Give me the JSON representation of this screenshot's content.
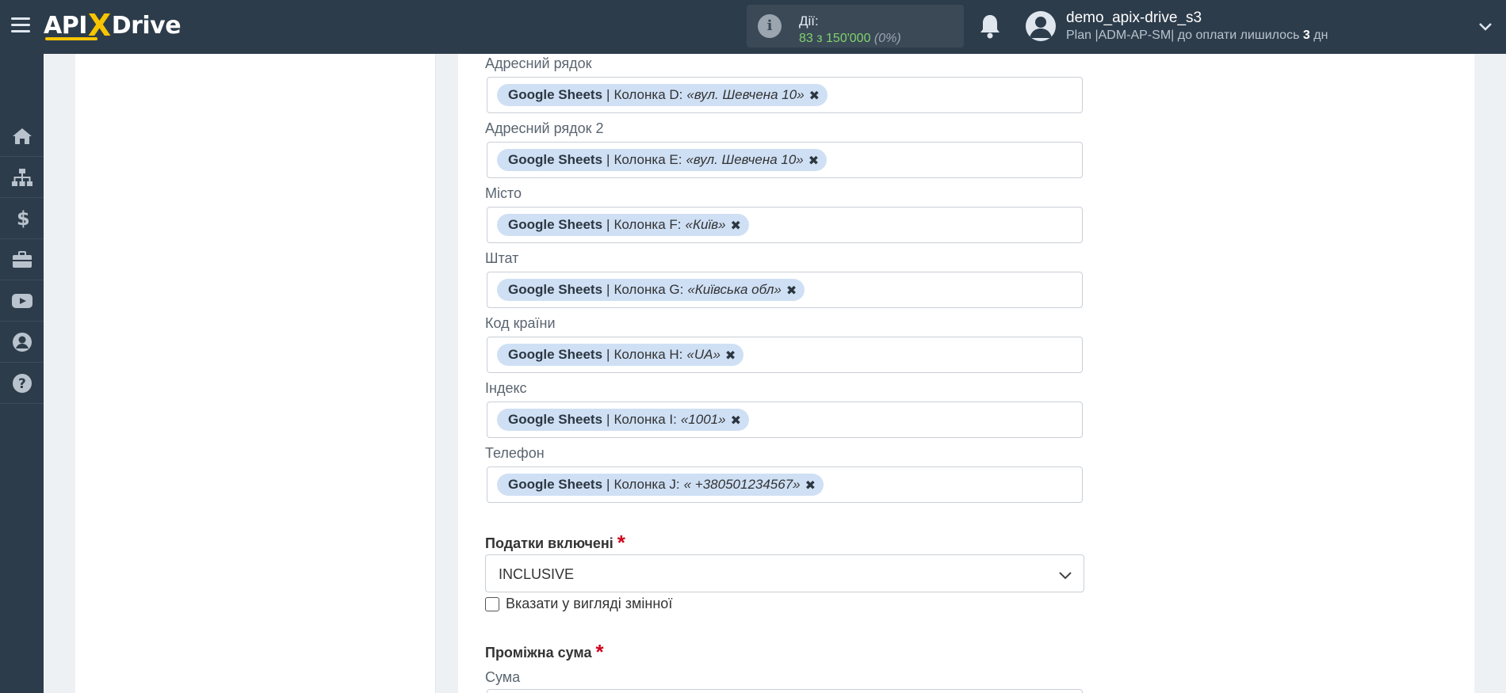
{
  "header": {
    "logo_left": "API",
    "logo_x": "X",
    "logo_right": "Drive",
    "actions_label": "Дії:",
    "actions_count": "83 з 150'000",
    "actions_percent": "(0%)",
    "user_name": "demo_apix-drive_s3",
    "plan_prefix": "Plan |ADM-AP-SM| до оплати лишилось",
    "plan_days": "3",
    "plan_suffix": "дн"
  },
  "sidebar": {
    "items": [
      {
        "icon": "home-icon"
      },
      {
        "icon": "sitemap-icon"
      },
      {
        "icon": "dollar-icon"
      },
      {
        "icon": "briefcase-icon"
      },
      {
        "icon": "youtube-icon"
      },
      {
        "icon": "user-circle-icon"
      },
      {
        "icon": "help-icon"
      }
    ]
  },
  "fields": [
    {
      "label": "Адресний рядок",
      "source": "Google Sheets",
      "sep": "|",
      "column": "Колонка D:",
      "value": "«вул. Шевчена 10»"
    },
    {
      "label": "Адресний рядок 2",
      "source": "Google Sheets",
      "sep": "|",
      "column": "Колонка E:",
      "value": "«вул. Шевчена 10»"
    },
    {
      "label": "Місто",
      "source": "Google Sheets",
      "sep": "|",
      "column": "Колонка F:",
      "value": "«Київ»"
    },
    {
      "label": "Штат",
      "source": "Google Sheets",
      "sep": "|",
      "column": "Колонка G:",
      "value": "«Київська обл»"
    },
    {
      "label": "Код країни",
      "source": "Google Sheets",
      "sep": "|",
      "column": "Колонка H:",
      "value": "«UA»"
    },
    {
      "label": "Індекс",
      "source": "Google Sheets",
      "sep": "|",
      "column": "Колонка I:",
      "value": "«1001»"
    },
    {
      "label": "Телефон",
      "source": "Google Sheets",
      "sep": "|",
      "column": "Колонка J:",
      "value": "« +380501234567»"
    }
  ],
  "taxes": {
    "label": "Податки включені",
    "required_mark": "*",
    "selected": "INCLUSIVE",
    "checkbox_label": "Вказати у вигляді змінної"
  },
  "subtotal": {
    "label": "Проміжна сума",
    "required_mark": "*",
    "sub_label": "Сума"
  },
  "colors": {
    "topbar": "#2d3c4b",
    "accent_yellow": "#f7c400",
    "tag_bg": "#cfe0f5",
    "required": "#d0021b",
    "actions_green": "#7fd36b"
  }
}
